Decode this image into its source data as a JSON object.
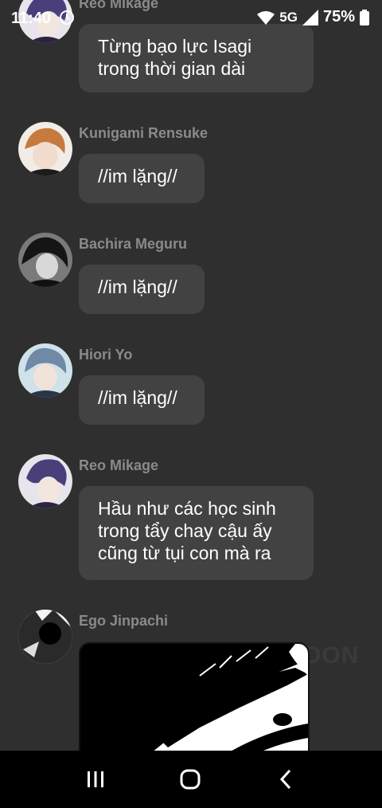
{
  "status_bar": {
    "time": "11:40",
    "network": "5G",
    "battery": "75%"
  },
  "messages": [
    {
      "sender": "Reo Mikage",
      "text_lines": [
        "Từng bạo lực Isagi",
        "trong thời gian dài"
      ]
    },
    {
      "sender": "Kunigami Rensuke",
      "text_lines": [
        "//im lặng//"
      ]
    },
    {
      "sender": "Bachira Meguru",
      "text_lines": [
        "//im lặng//"
      ]
    },
    {
      "sender": "Hiori Yo",
      "text_lines": [
        "//im lặng//"
      ]
    },
    {
      "sender": "Reo Mikage",
      "text_lines": [
        "Hầu như các học sinh",
        "trong tẩy chay cậu ấy",
        "cũng từ tụi con mà ra"
      ]
    },
    {
      "sender": "Ego Jinpachi",
      "attachment": "manga-panel-image"
    }
  ],
  "watermark": "OON",
  "nav": {
    "icons": [
      "recents-icon",
      "home-icon",
      "back-icon"
    ]
  },
  "colors": {
    "background": "#2f2f2f",
    "bubble": "#424242",
    "sender_name": "#8a8a8a",
    "nav_bar": "#000000"
  }
}
